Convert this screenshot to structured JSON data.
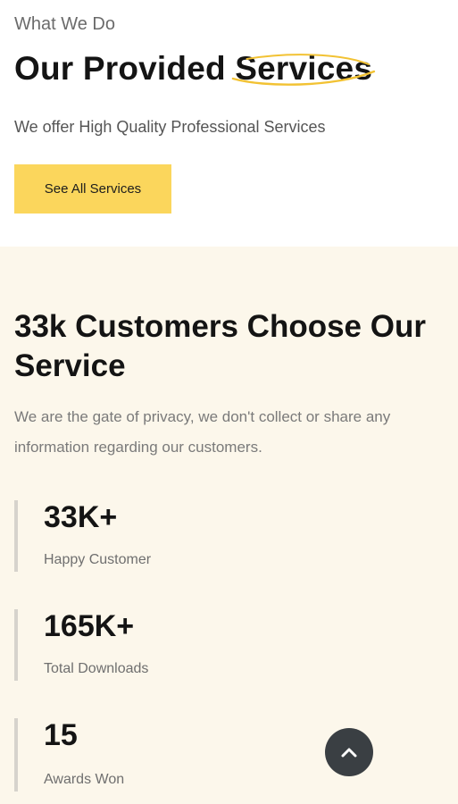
{
  "intro": {
    "eyebrow": "What We Do",
    "title_prefix": "Our Provided ",
    "title_highlight": "Services",
    "subtitle": "We offer High Quality Professional Services",
    "button_label": "See All Services"
  },
  "stats": {
    "title": "33k Customers Choose Our Service",
    "description": "We are the gate of privacy, we don't collect or share any information regarding our customers.",
    "items": [
      {
        "value": "33K+",
        "label": "Happy Customer"
      },
      {
        "value": "165K+",
        "label": "Total Downloads"
      },
      {
        "value": "15",
        "label": "Awards Won"
      }
    ]
  },
  "colors": {
    "accent": "#fbd65c",
    "stats_background": "#fcf7eb",
    "scroll_button": "#3a3f43"
  },
  "icons": {
    "scroll_top": "chevron-up-icon",
    "title_decoration": "swoosh-underline"
  }
}
